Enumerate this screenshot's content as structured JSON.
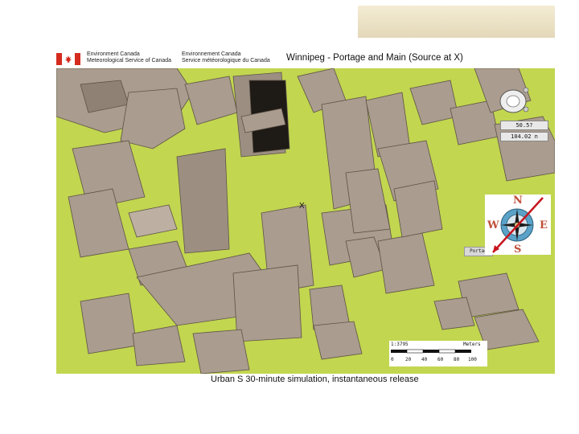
{
  "header": {
    "org_en": [
      "Environment Canada",
      "Meteorological Service of Canada"
    ],
    "org_fr": [
      "Environnement Canada",
      "Service météorologique du Canada"
    ],
    "title": "Winnipeg - Portage and Main (Source at X)"
  },
  "map": {
    "source_marker": "X",
    "street_label": "Portag",
    "ground_color": "#c2d650",
    "building_color": "#aa9c8e",
    "plume_color": "#1e1a16"
  },
  "compass": {
    "north": "N",
    "south": "S",
    "east": "E",
    "west": "W",
    "accent_color": "#c0503a",
    "arrow_color": "#c8141e"
  },
  "hud": {
    "readout_1": "50.5?",
    "readout_2": "104.02 n"
  },
  "scale": {
    "ratio": "1:3795",
    "unit": "Meters",
    "ticks": [
      "0",
      "20",
      "40",
      "60",
      "80",
      "100"
    ]
  },
  "caption": "Urban S 30-minute simulation, instantaneous release"
}
